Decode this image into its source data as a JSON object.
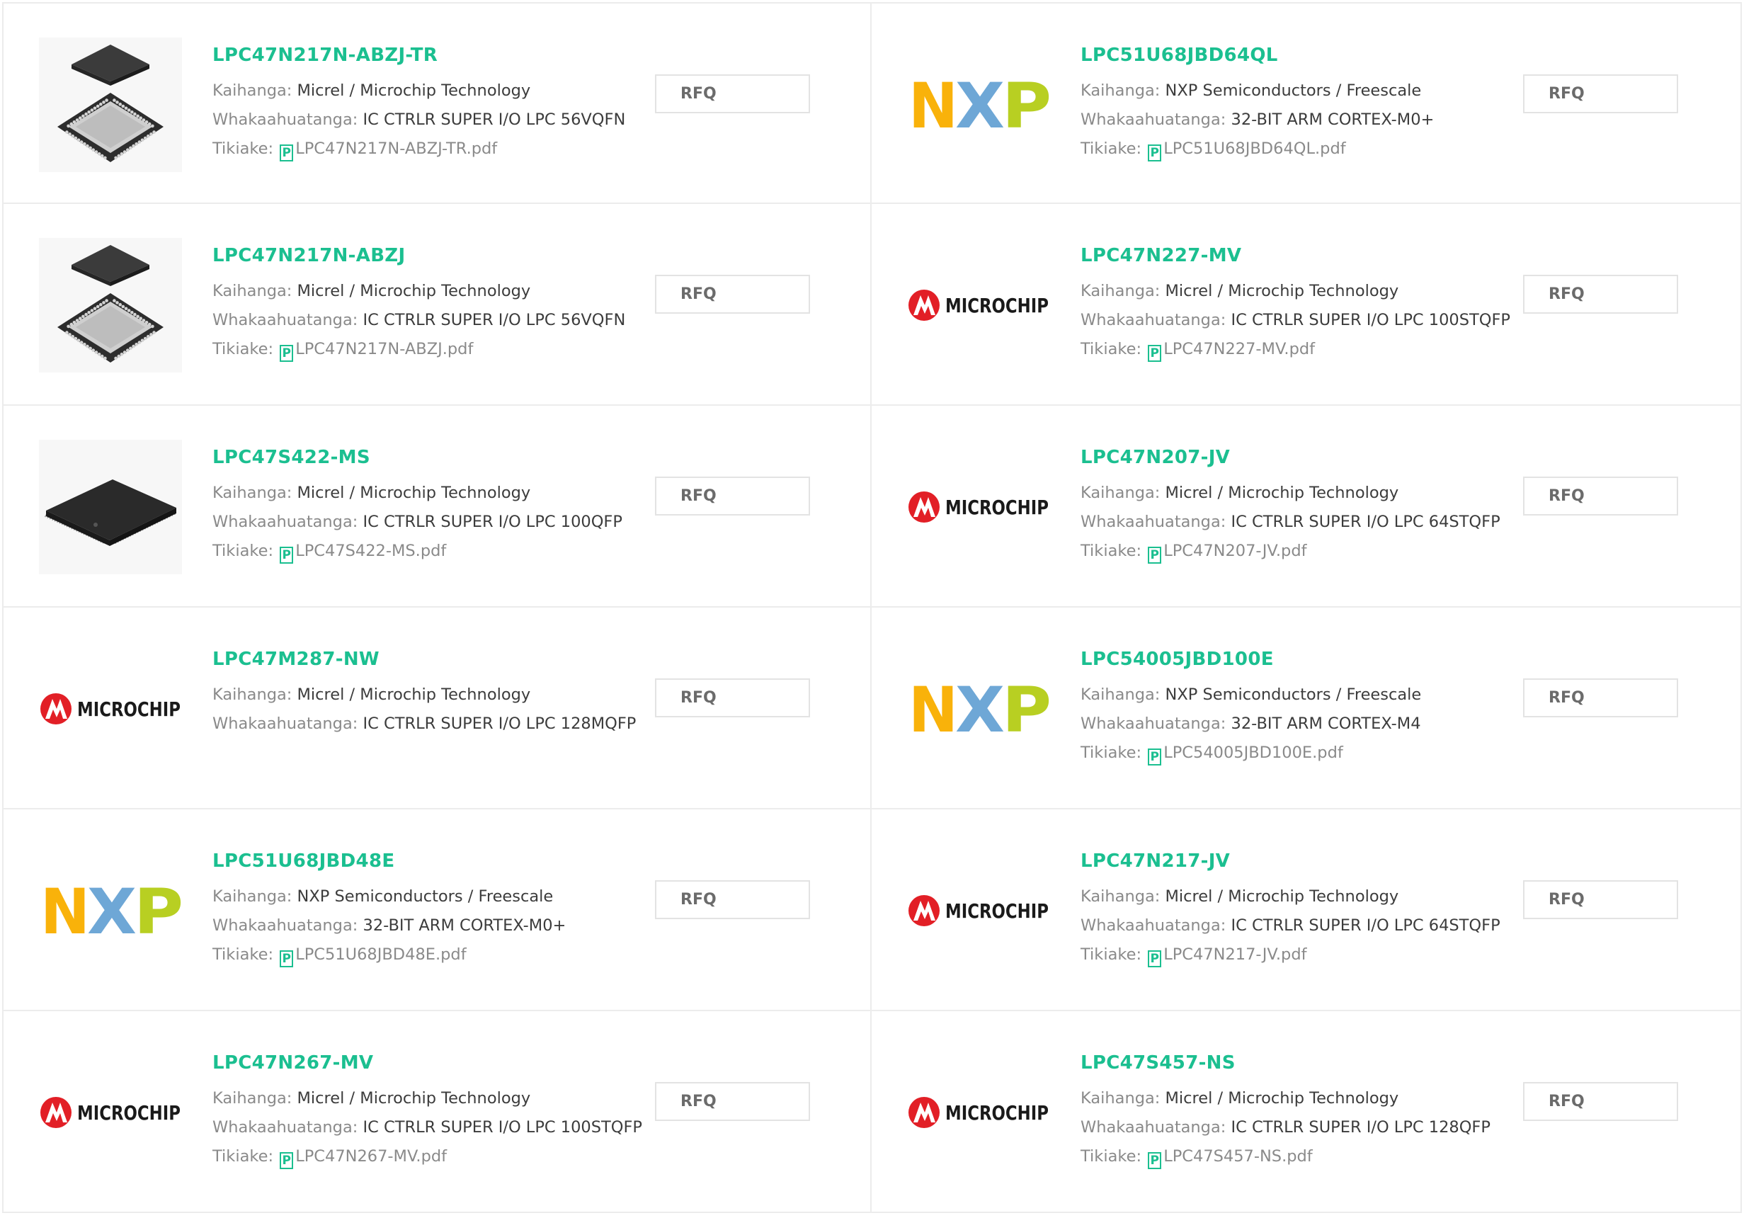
{
  "labels": {
    "manufacturer": "Kaihanga:",
    "description": "Whakaahuatanga:",
    "datasheet": "Tikiake:"
  },
  "rfq_label": "RFQ",
  "pdf_icon_glyph": "P",
  "colors": {
    "accent": "#1bbf90",
    "border": "#ececec"
  },
  "brand_logos": {
    "nxp": {
      "letters": [
        "N",
        "X",
        "P"
      ],
      "colors": [
        "#f9b20a",
        "#6ea7d6",
        "#b8cf22"
      ]
    },
    "microchip": {
      "wordmark": "MICROCHIP",
      "mark_color": "#e21f26",
      "text_color": "#1a1a1a"
    }
  },
  "products": [
    {
      "part": "LPC47N217N-ABZJ-TR",
      "manufacturer": "Micrel / Microchip Technology",
      "description": "IC CTRLR SUPER I/O LPC 56VQFN",
      "datasheet": "LPC47N217N-ABZJ-TR.pdf",
      "image": "qfn-chip-photo"
    },
    {
      "part": "LPC51U68JBD64QL",
      "manufacturer": "NXP Semiconductors / Freescale",
      "description": "32-BIT ARM CORTEX-M0+",
      "datasheet": "LPC51U68JBD64QL.pdf",
      "image": "nxp-logo"
    },
    {
      "part": "LPC47N217N-ABZJ",
      "manufacturer": "Micrel / Microchip Technology",
      "description": "IC CTRLR SUPER I/O LPC 56VQFN",
      "datasheet": "LPC47N217N-ABZJ.pdf",
      "image": "qfn-chip-photo"
    },
    {
      "part": "LPC47N227-MV",
      "manufacturer": "Micrel / Microchip Technology",
      "description": "IC CTRLR SUPER I/O LPC 100STQFP",
      "datasheet": "LPC47N227-MV.pdf",
      "image": "microchip-logo"
    },
    {
      "part": "LPC47S422-MS",
      "manufacturer": "Micrel / Microchip Technology",
      "description": "IC CTRLR SUPER I/O LPC 100QFP",
      "datasheet": "LPC47S422-MS.pdf",
      "image": "qfp-chip-photo"
    },
    {
      "part": "LPC47N207-JV",
      "manufacturer": "Micrel / Microchip Technology",
      "description": "IC CTRLR SUPER I/O LPC 64STQFP",
      "datasheet": "LPC47N207-JV.pdf",
      "image": "microchip-logo"
    },
    {
      "part": "LPC47M287-NW",
      "manufacturer": "Micrel / Microchip Technology",
      "description": "IC CTRLR SUPER I/O LPC 128MQFP",
      "datasheet": null,
      "image": "microchip-logo"
    },
    {
      "part": "LPC54005JBD100E",
      "manufacturer": "NXP Semiconductors / Freescale",
      "description": "32-BIT ARM CORTEX-M4",
      "datasheet": "LPC54005JBD100E.pdf",
      "image": "nxp-logo"
    },
    {
      "part": "LPC51U68JBD48E",
      "manufacturer": "NXP Semiconductors / Freescale",
      "description": "32-BIT ARM CORTEX-M0+",
      "datasheet": "LPC51U68JBD48E.pdf",
      "image": "nxp-logo"
    },
    {
      "part": "LPC47N217-JV",
      "manufacturer": "Micrel / Microchip Technology",
      "description": "IC CTRLR SUPER I/O LPC 64STQFP",
      "datasheet": "LPC47N217-JV.pdf",
      "image": "microchip-logo"
    },
    {
      "part": "LPC47N267-MV",
      "manufacturer": "Micrel / Microchip Technology",
      "description": "IC CTRLR SUPER I/O LPC 100STQFP",
      "datasheet": "LPC47N267-MV.pdf",
      "image": "microchip-logo"
    },
    {
      "part": "LPC47S457-NS",
      "manufacturer": "Micrel / Microchip Technology",
      "description": "IC CTRLR SUPER I/O LPC 128QFP",
      "datasheet": "LPC47S457-NS.pdf",
      "image": "microchip-logo"
    }
  ]
}
